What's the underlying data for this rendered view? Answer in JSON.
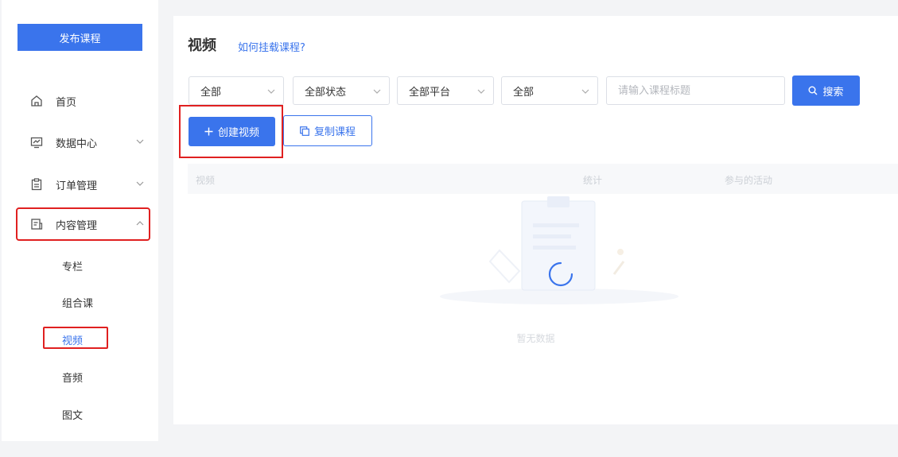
{
  "sidebar": {
    "publish_label": "发布课程",
    "items": [
      {
        "label": "首页",
        "icon": "home-icon"
      },
      {
        "label": "数据中心",
        "icon": "chart-icon"
      },
      {
        "label": "订单管理",
        "icon": "clipboard-icon"
      },
      {
        "label": "内容管理",
        "icon": "document-icon"
      }
    ],
    "sub_items": [
      {
        "label": "专栏"
      },
      {
        "label": "组合课"
      },
      {
        "label": "视频"
      },
      {
        "label": "音频"
      },
      {
        "label": "图文"
      }
    ]
  },
  "main": {
    "title": "视频",
    "help_link": "如何挂载课程?",
    "filters": [
      {
        "value": "全部"
      },
      {
        "value": "全部状态"
      },
      {
        "value": "全部平台"
      },
      {
        "value": "全部"
      }
    ],
    "search_placeholder": "请输入课程标题",
    "search_label": "搜索",
    "create_label": "创建视频",
    "copy_label": "复制课程",
    "columns": [
      "视频",
      "统计",
      "参与的活动"
    ],
    "empty_text": "暂无数据"
  },
  "colors": {
    "accent": "#3a74ec",
    "highlight": "#e02020"
  }
}
